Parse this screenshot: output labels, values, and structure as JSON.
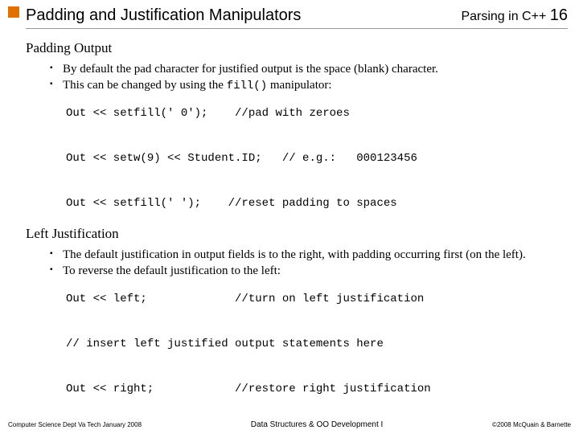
{
  "header": {
    "title": "Padding and Justification Manipulators",
    "topic": "Parsing in C++",
    "page": "16"
  },
  "sec1": {
    "heading": "Padding Output",
    "b1": "By default the pad character for justified output is the space (blank) character.",
    "b2_pre": "This can be changed by using the ",
    "b2_code": "fill()",
    "b2_post": " manipulator:",
    "code": "Out << setfill(' 0');    //pad with zeroes\n\nOut << setw(9) << Student.ID;   // e.g.:   000123456\n\nOut << setfill(' ');    //reset padding to spaces"
  },
  "sec2": {
    "heading": "Left Justification",
    "b1": "The default justification in output fields is to the right, with padding occurring first (on the left).",
    "b2": "To reverse the default justification to the left:",
    "code": "Out << left;             //turn on left justification\n\n// insert left justified output statements here\n\nOut << right;            //restore right justification"
  },
  "footer": {
    "left": "Computer Science Dept Va Tech January 2008",
    "center": "Data Structures & OO Development I",
    "right": "©2008 McQuain & Barnette"
  }
}
